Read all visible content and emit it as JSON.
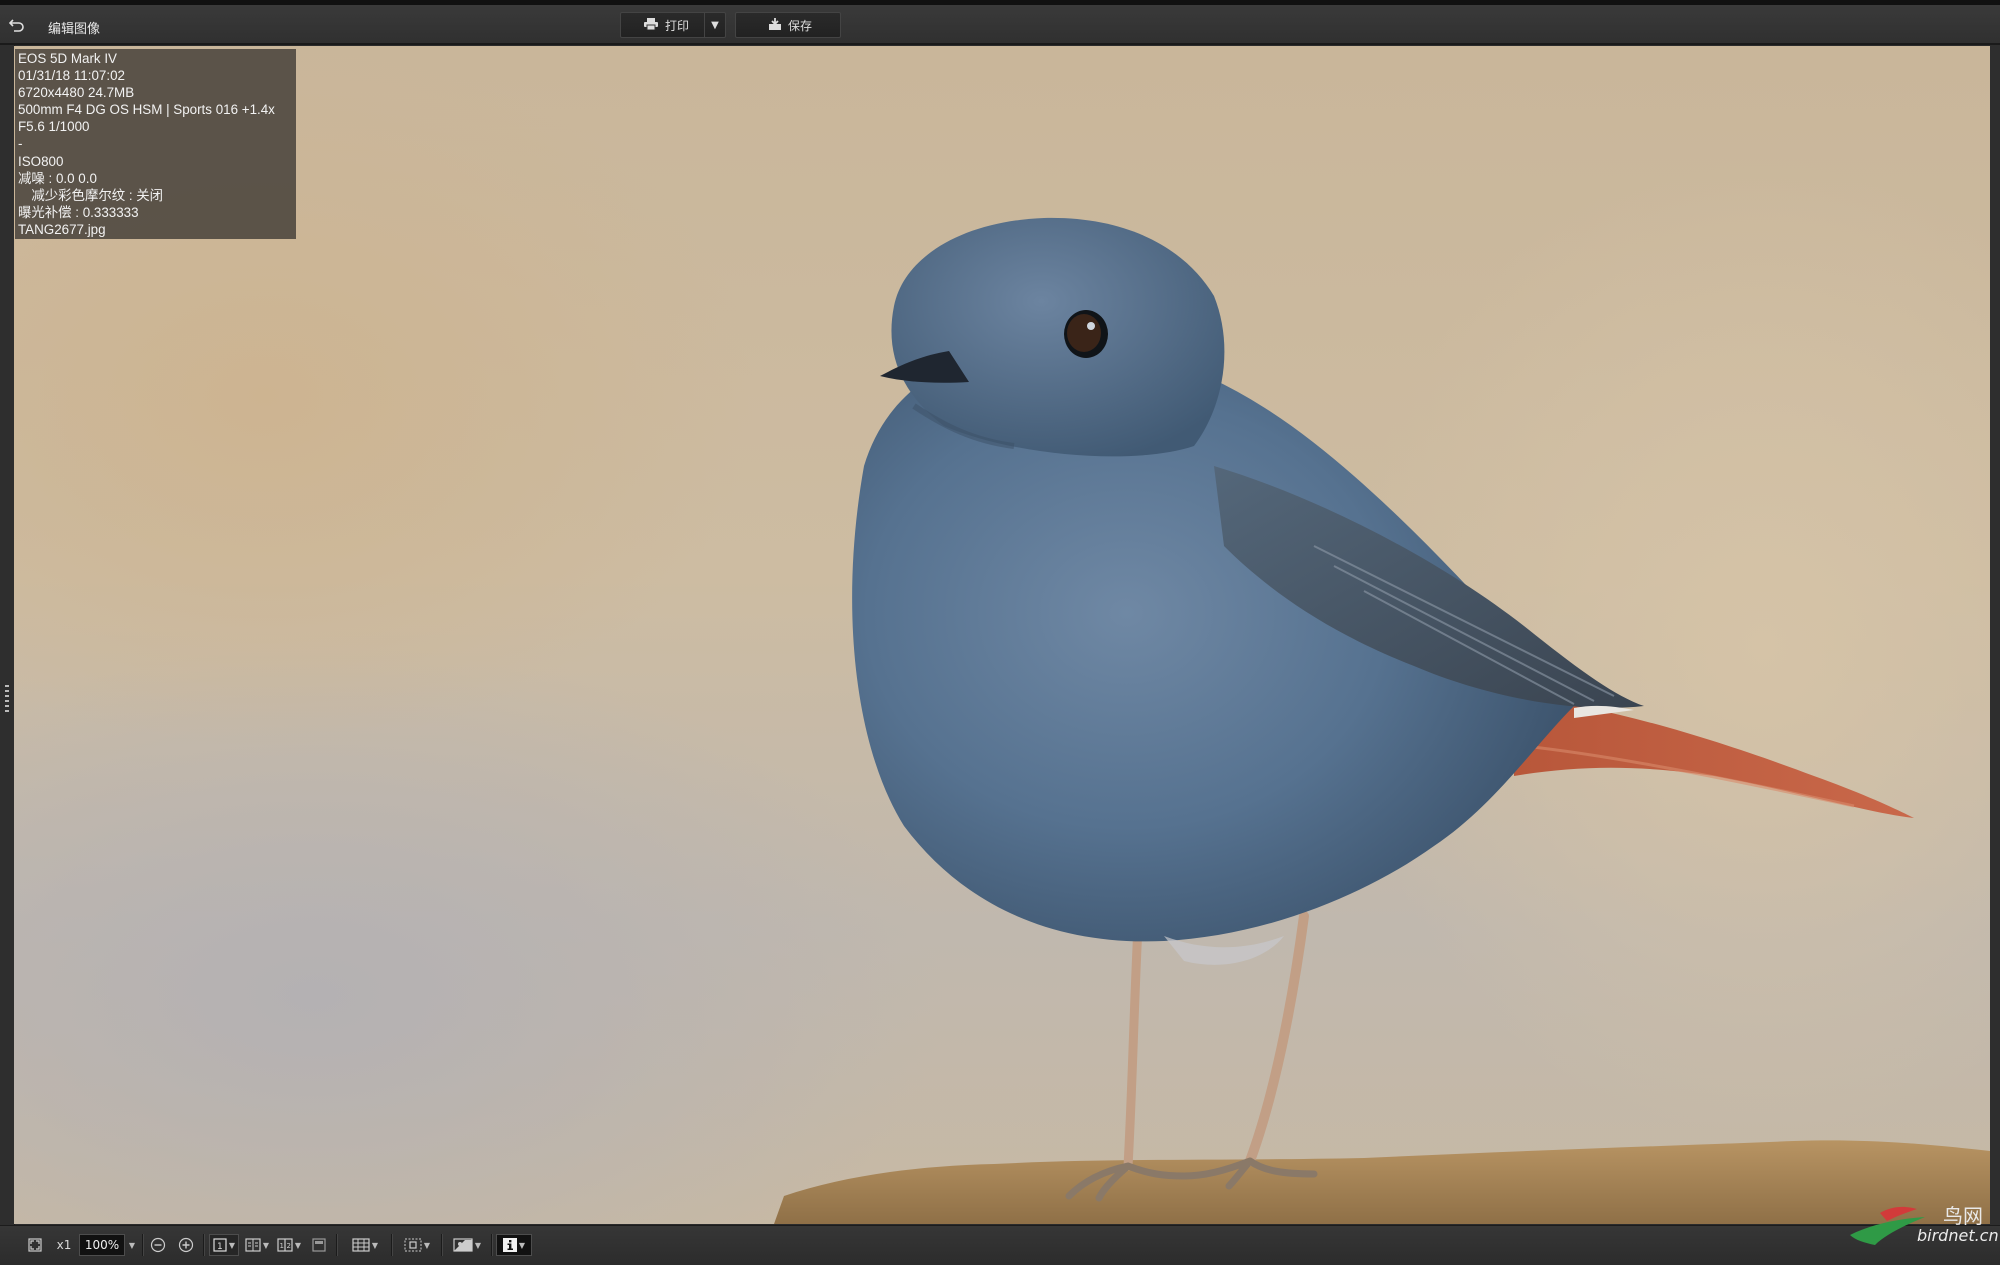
{
  "app": {
    "title": "编辑图像"
  },
  "toolbar": {
    "print_label": "打印",
    "save_label": "保存"
  },
  "info_overlay": {
    "camera": "EOS 5D Mark IV",
    "datetime": "01/31/18 11:07:02",
    "dimensions": "6720x4480 24.7MB",
    "lens": "500mm F4 DG OS HSM | Sports 016 +1.4x",
    "exposure": "F5.6 1/1000",
    "dash": "-",
    "iso": "ISO800",
    "noise_reduction": "减噪 : 0.0 0.0",
    "moire": "　减少彩色摩尔纹 : 关闭",
    "exposure_comp": "曝光补偿 : 0.333333",
    "filename": "TANG2677.jpg"
  },
  "bottom_toolbar": {
    "magnify_label": "x1",
    "zoom_value": "100%"
  },
  "watermark": {
    "cn": "鸟网",
    "url": "birdnet.cn"
  },
  "colors": {
    "bird_body": "#5b7795",
    "tail": "#c8583a",
    "background_bokeh": "#c9b69a"
  }
}
